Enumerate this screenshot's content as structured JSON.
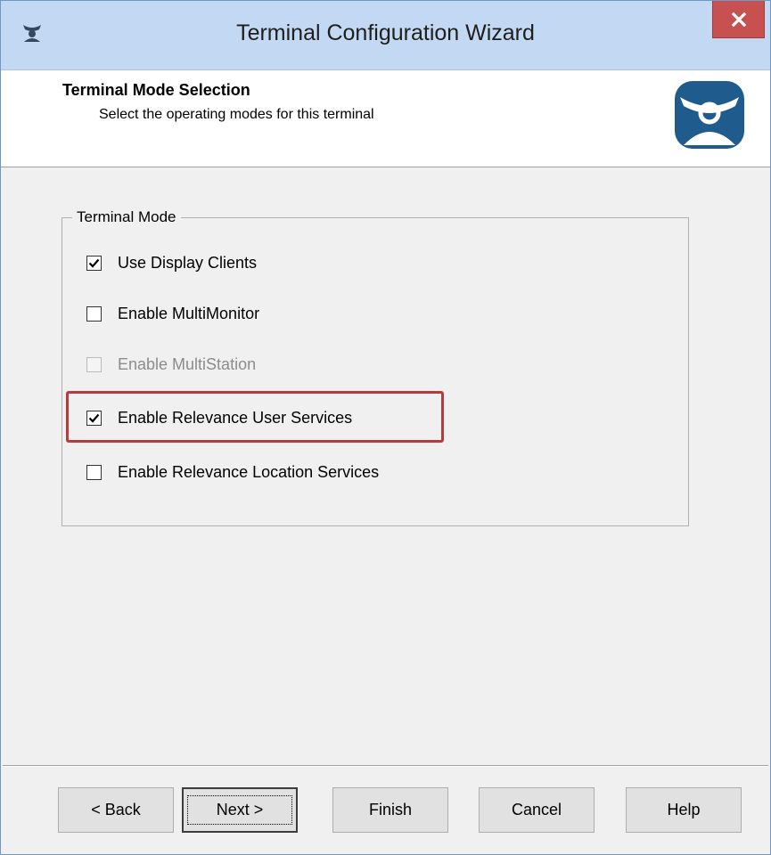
{
  "window": {
    "title": "Terminal Configuration Wizard"
  },
  "icons": {
    "app": "app-icon",
    "close": "close-icon",
    "logo": "thinmanager-logo-icon",
    "check": "check-icon"
  },
  "header": {
    "title": "Terminal Mode Selection",
    "subtitle": "Select the operating modes for this terminal"
  },
  "group": {
    "legend": "Terminal Mode",
    "options": [
      {
        "label": "Use Display Clients",
        "checked": true,
        "enabled": true
      },
      {
        "label": "Enable MultiMonitor",
        "checked": false,
        "enabled": true
      },
      {
        "label": "Enable MultiStation",
        "checked": false,
        "enabled": false
      },
      {
        "label": "Enable Relevance User Services",
        "checked": true,
        "enabled": true,
        "highlighted": true
      },
      {
        "label": "Enable Relevance Location Services",
        "checked": false,
        "enabled": true
      }
    ]
  },
  "buttons": {
    "back": "< Back",
    "next": "Next >",
    "finish": "Finish",
    "cancel": "Cancel",
    "help": "Help"
  },
  "colors": {
    "titlebar": "#c3d8f2",
    "close": "#c75050",
    "highlight": "#b83a3f",
    "logo": "#1f5b8c"
  }
}
